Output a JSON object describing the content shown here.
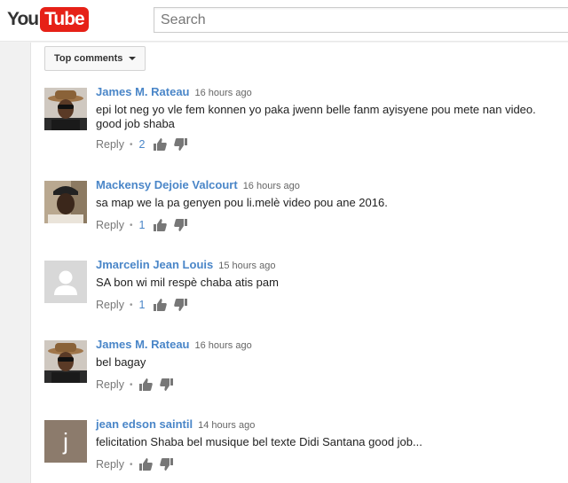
{
  "header": {
    "logo_you": "You",
    "logo_tube": "Tube",
    "search_placeholder": "Search"
  },
  "comments_toolbar": {
    "sort_label": "Top comments"
  },
  "comments": [
    {
      "author": "James M. Rateau",
      "time": "16 hours ago",
      "text": "epi lot neg yo vle fem konnen yo paka jwenn belle fanm ayisyene pou mete nan video. good job shaba",
      "reply_label": "Reply",
      "likes": "2",
      "avatar": "photo-hat"
    },
    {
      "author": "Mackensy Dejoie Valcourt",
      "time": "16 hours ago",
      "text": "sa map we la pa genyen pou li.melè video pou ane 2016.",
      "reply_label": "Reply",
      "likes": "1",
      "avatar": "photo-cap"
    },
    {
      "author": "Jmarcelin Jean Louis",
      "time": "15 hours ago",
      "text": "SA bon wi mil respè chaba atis pam",
      "reply_label": "Reply",
      "likes": "1",
      "avatar": "default-user"
    },
    {
      "author": "James M. Rateau",
      "time": "16 hours ago",
      "text": "bel bagay",
      "reply_label": "Reply",
      "likes": "",
      "avatar": "photo-hat"
    },
    {
      "author": "jean edson saintil",
      "time": "14 hours ago",
      "text": "felicitation Shaba bel musique bel texte Didi Santana good job...",
      "reply_label": "Reply",
      "likes": "",
      "avatar": "letter-j",
      "avatar_letter": "j"
    }
  ],
  "colors": {
    "brand_red": "#e62117",
    "author_link": "#4a86c8"
  }
}
